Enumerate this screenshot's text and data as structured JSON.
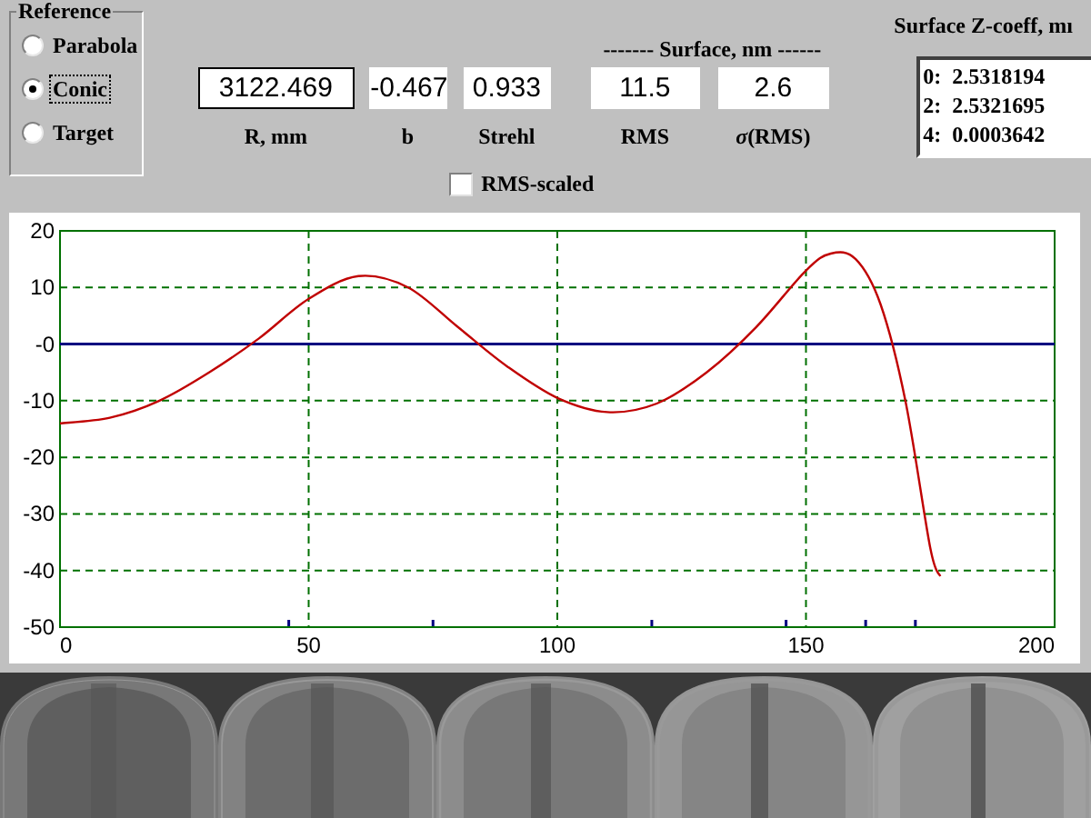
{
  "reference": {
    "title": "Reference",
    "options": [
      {
        "label": "Parabola",
        "selected": false,
        "focused": false
      },
      {
        "label": "Conic",
        "selected": true,
        "focused": true
      },
      {
        "label": "Target",
        "selected": false,
        "focused": false
      }
    ]
  },
  "fields": [
    {
      "value": "3122.469",
      "label": "R, mm",
      "editable": true
    },
    {
      "value": "-0.467",
      "label": "b",
      "editable": false
    },
    {
      "value": "0.933",
      "label": "Strehl",
      "editable": false
    },
    {
      "value": "11.5",
      "label": "RMS",
      "editable": false
    },
    {
      "value": "2.6",
      "label": "*σ*(RMS)",
      "editable": false
    }
  ],
  "surface_header": "------- Surface, nm ------",
  "rms_scaled": {
    "label": "RMS-scaled",
    "checked": false
  },
  "z_coeff": {
    "title": "Surface Z-coeff, mı",
    "items": [
      "0:  2.5318194",
      "2:  2.5321695",
      "4:  0.0003642"
    ]
  },
  "chart_data": {
    "type": "line",
    "x": [
      0,
      10,
      20,
      30,
      40,
      50,
      60,
      70,
      80,
      90,
      100,
      110,
      120,
      130,
      140,
      150,
      155,
      160,
      165,
      170,
      175,
      177
    ],
    "series": [
      {
        "color": "#c00000",
        "values": [
          -14,
          -13,
          -10,
          -5,
          1,
          8,
          12,
          10,
          3,
          -4,
          -9.5,
          -12,
          -10.5,
          -5,
          3,
          13,
          16,
          15,
          7,
          -10,
          -36,
          -41
        ]
      }
    ],
    "xlim": [
      0,
      200
    ],
    "ylim": [
      -50,
      20
    ],
    "xticks": [
      0,
      50,
      100,
      150,
      200
    ],
    "yticks": [
      20,
      10,
      {
        "value": 0,
        "label": "-0"
      },
      -10,
      -20,
      -30,
      -40,
      -50
    ],
    "grid": true,
    "ref_lines": [
      {
        "axis": "y",
        "value": 0,
        "color": "#000080"
      }
    ]
  }
}
